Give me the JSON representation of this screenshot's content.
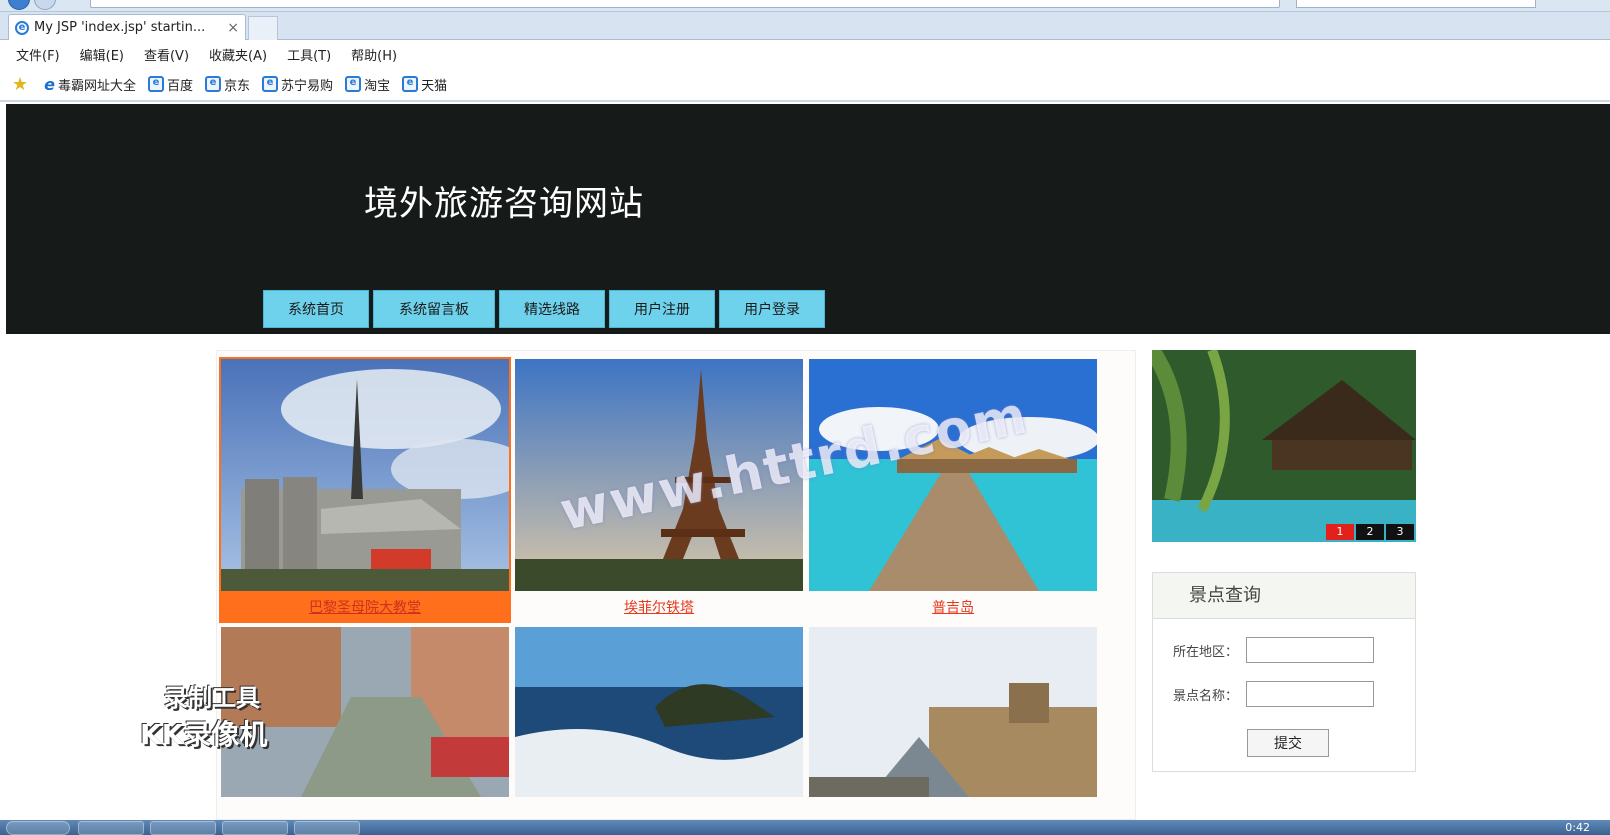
{
  "browser": {
    "tab_title": "My JSP 'index.jsp' startin...",
    "tab_close": "×",
    "menu": [
      "文件(F)",
      "编辑(E)",
      "查看(V)",
      "收藏夹(A)",
      "工具(T)",
      "帮助(H)"
    ],
    "favorites": [
      "毒霸网址大全",
      "百度",
      "京东",
      "苏宁易购",
      "淘宝",
      "天猫"
    ]
  },
  "site": {
    "title": "境外旅游咨询网站",
    "nav": [
      "系统首页",
      "系统留言板",
      "精选线路",
      "用户注册",
      "用户登录"
    ]
  },
  "gallery": {
    "captions": [
      "巴黎圣母院大教堂",
      "埃菲尔铁塔",
      "普吉岛"
    ]
  },
  "slider": {
    "pages": [
      "1",
      "2",
      "3"
    ],
    "active_page": "1"
  },
  "search": {
    "title": "景点查询",
    "region_label": "所在地区：",
    "name_label": "景点名称：",
    "submit_label": "提交"
  },
  "watermark": {
    "site": "www.httrd.com",
    "recorder_line1": "录制工具",
    "recorder_line2": "KK录像机"
  },
  "taskbar": {
    "clock": "0:42"
  },
  "colors": {
    "header_bg": "#161a18",
    "nav_bg": "#6fd2ec",
    "caption": "#e63a1e",
    "active_tile": "#ff6f1c",
    "slider_active_dot": "#e3201b"
  }
}
